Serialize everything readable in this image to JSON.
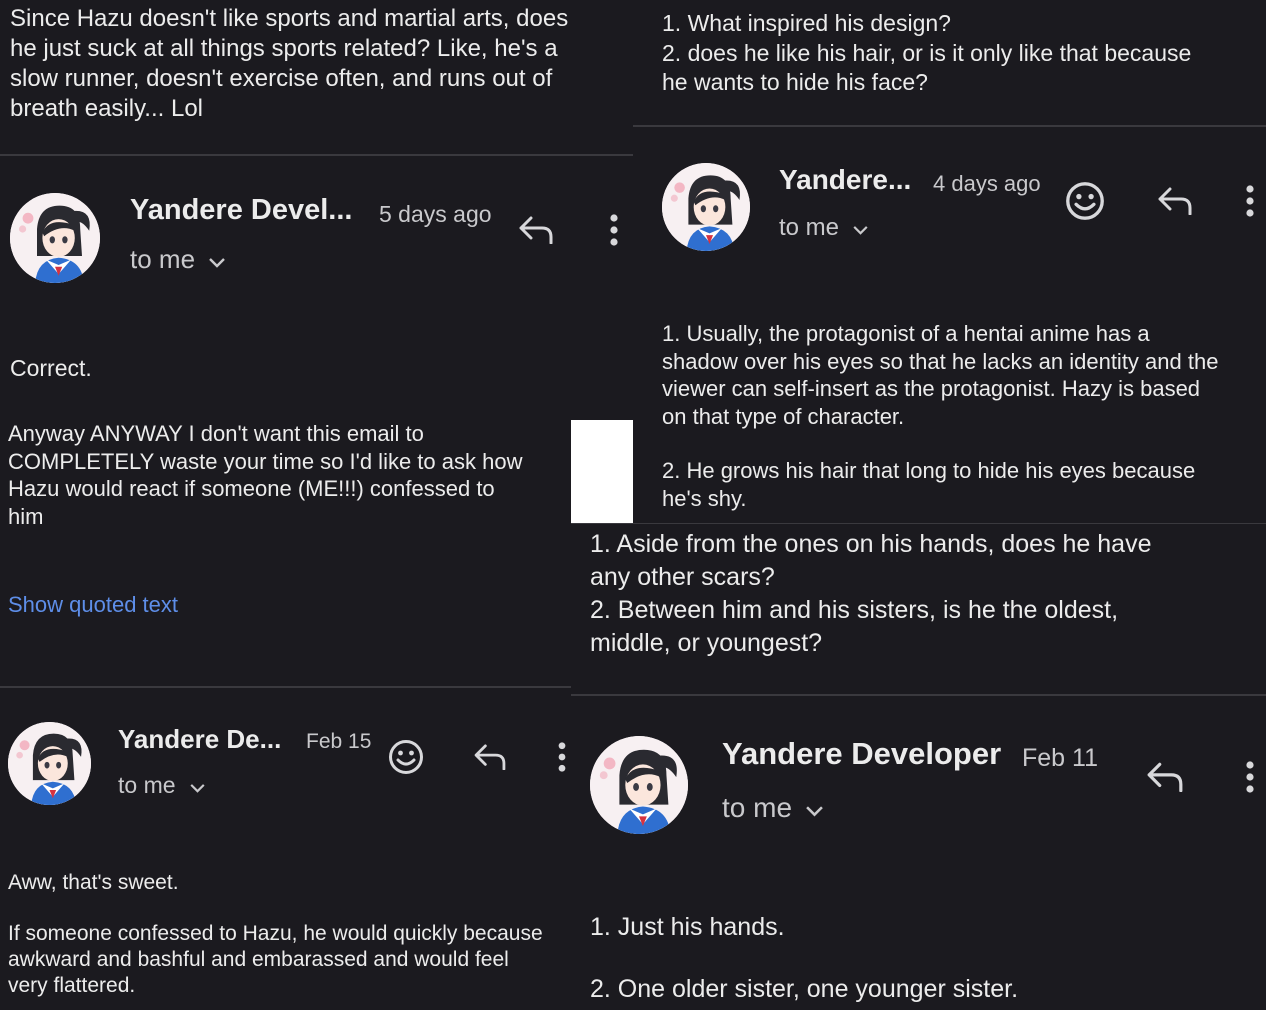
{
  "left": {
    "question1": "Since Hazu doesn't like sports and martial arts, does\nhe just suck at all things sports related? Like, he's a\nslow runner, doesn't exercise often, and runs out of\nbreath easily... Lol",
    "reply1": {
      "sender": "Yandere Devel...",
      "time": "5 days ago",
      "to": "to me",
      "body": "Correct."
    },
    "question2": "Anyway ANYWAY I don't want this email to\nCOMPLETELY waste your time so I'd like to ask how\nHazu would react if someone (ME!!!) confessed to\nhim",
    "show_quoted": "Show quoted text",
    "reply2": {
      "sender": "Yandere De...",
      "time": "Feb 15",
      "to": "to me",
      "body1": "Aww, that's sweet.",
      "body2": "If someone confessed to Hazu, he would quickly because\nawkward and bashful and embarassed and would feel\nvery flattered."
    }
  },
  "right": {
    "question1": "1. What inspired his design?\n2. does he like his hair, or is it only like that because\nhe wants to hide his face?",
    "reply1": {
      "sender": "Yandere...",
      "time": "4 days ago",
      "to": "to me",
      "body1": "1. Usually, the protagonist of a hentai anime has a\nshadow over his eyes so that he lacks an identity and the\nviewer can self-insert as the protagonist. Hazy is based\non that type of character.",
      "body2": "2. He grows his hair that long to hide his eyes because\nhe's shy."
    },
    "question2": "1. Aside from the ones on his hands, does he have\nany other scars?\n2. Between him and his sisters, is he the oldest,\nmiddle, or youngest?",
    "reply2": {
      "sender": "Yandere Developer",
      "time": "Feb 11",
      "to": "to me",
      "body1": "1. Just his hands.",
      "body2": "2. One older sister, one younger sister."
    }
  },
  "icons": {
    "reply": "reply-arrow-icon",
    "more": "more-vertical-icon",
    "emoji": "smiley-emoji-icon",
    "chevron": "chevron-down-icon",
    "avatar": "anime-girl-avatar"
  },
  "colors": {
    "background": "#1b1a1f",
    "text": "#ececec",
    "link": "#5e8ee8",
    "divider": "#3a393e"
  }
}
